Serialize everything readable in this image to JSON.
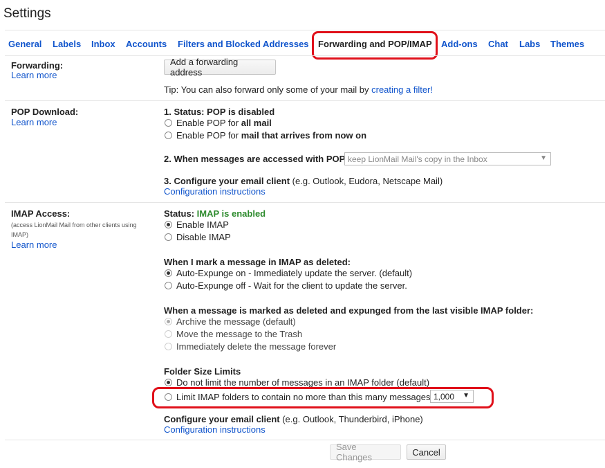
{
  "page": {
    "title": "Settings"
  },
  "tabs": [
    {
      "label": "General"
    },
    {
      "label": "Labels"
    },
    {
      "label": "Inbox"
    },
    {
      "label": "Accounts"
    },
    {
      "label": "Filters and Blocked Addresses"
    },
    {
      "label": "Forwarding and POP/IMAP",
      "active": true
    },
    {
      "label": "Add-ons"
    },
    {
      "label": "Chat"
    },
    {
      "label": "Labs"
    },
    {
      "label": "Themes"
    }
  ],
  "forwarding": {
    "title": "Forwarding:",
    "learn_more": "Learn more",
    "add_button": "Add a forwarding address",
    "tip_prefix": "Tip: You can also forward only some of your mail by ",
    "tip_link": "creating a filter!"
  },
  "pop": {
    "title": "POP Download:",
    "learn_more": "Learn more",
    "status_label": "1. Status: POP is disabled",
    "option_all_prefix": "Enable POP for ",
    "option_all_bold": "all mail",
    "option_now_prefix": "Enable POP for ",
    "option_now_bold": "mail that arrives from now on",
    "accessed_label": "2. When messages are accessed with POP",
    "accessed_select": "keep LionMail Mail's copy in the Inbox",
    "configure_label": "3. Configure your email client",
    "configure_hint": "(e.g. Outlook, Eudora, Netscape Mail)",
    "config_link": "Configuration instructions"
  },
  "imap": {
    "title": "IMAP Access:",
    "note": "(access LionMail Mail from other clients using IMAP)",
    "learn_more": "Learn more",
    "status_prefix": "Status: ",
    "status_value": "IMAP is enabled",
    "enable": "Enable IMAP",
    "disable": "Disable IMAP",
    "deleted_heading": "When I mark a message in IMAP as deleted:",
    "expunge_on": "Auto-Expunge on - Immediately update the server. (default)",
    "expunge_off": "Auto-Expunge off - Wait for the client to update the server.",
    "expunged_heading": "When a message is marked as deleted and expunged from the last visible IMAP folder:",
    "archive": "Archive the message (default)",
    "trash": "Move the message to the Trash",
    "delete_forever": "Immediately delete the message forever",
    "folder_heading": "Folder Size Limits",
    "no_limit": "Do not limit the number of messages in an IMAP folder (default)",
    "limit": "Limit IMAP folders to contain no more than this many messages",
    "limit_select": "1,000",
    "configure_label": "Configure your email client",
    "configure_hint": "(e.g. Outlook, Thunderbird, iPhone)",
    "config_link": "Configuration instructions"
  },
  "footer": {
    "save": "Save Changes",
    "cancel": "Cancel"
  },
  "colors": {
    "link": "#1155cc",
    "highlight": "#e0101a",
    "enabled_green": "#2e8b2e"
  }
}
